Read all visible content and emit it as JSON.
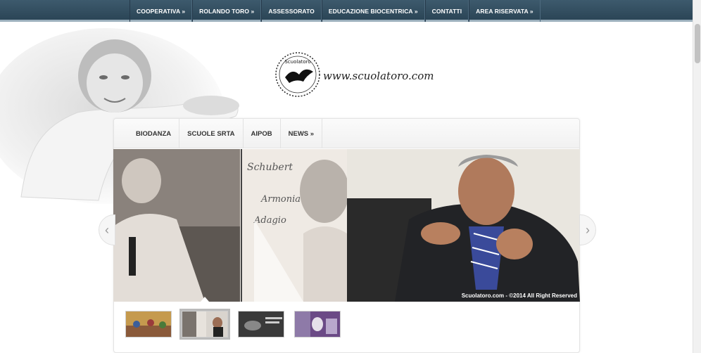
{
  "topnav": {
    "items": [
      {
        "label": "COOPERATIVA »"
      },
      {
        "label": "ROLANDO TORO »"
      },
      {
        "label": "ASSESSORATO"
      },
      {
        "label": "EDUCAZIONE BIOCENTRICA »"
      },
      {
        "label": "CONTATTI"
      },
      {
        "label": "AREA RISERVATA »"
      }
    ]
  },
  "header": {
    "logo_text": "Scuolatoro",
    "site_url": "www.scuolatoro.com"
  },
  "subnav": {
    "items": [
      {
        "label": "BIODANZA"
      },
      {
        "label": "SCUOLE SRTA"
      },
      {
        "label": "AIPOB"
      },
      {
        "label": "NEWS »"
      }
    ]
  },
  "slider": {
    "caption": "Scuolatoro.com - ©2014 All Right Reserved",
    "prev_icon": "chevron-left-icon",
    "next_icon": "chevron-right-icon",
    "prev_glyph": "‹",
    "next_glyph": "›",
    "active_thumb": 2,
    "thumbs": [
      "thumb-1",
      "thumb-2",
      "thumb-3",
      "thumb-4"
    ]
  },
  "colors": {
    "topnav_bg": "#2f4b5e",
    "topnav_border": "#9db0bd",
    "panel_border": "#e3e3e3"
  }
}
